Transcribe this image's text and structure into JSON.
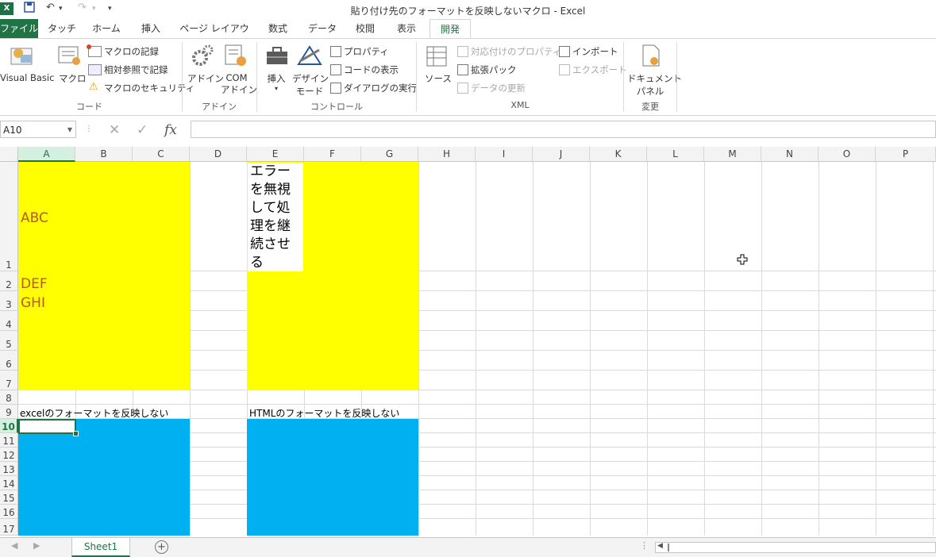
{
  "window": {
    "title": "貼り付け先のフォーマットを反映しないマクロ - Excel",
    "logo": "X"
  },
  "quick_access": {
    "save_icon": "save-icon",
    "undo_icon": "undo-icon",
    "redo_icon": "redo-icon",
    "customize": "▾"
  },
  "tabs": [
    "ファイル",
    "タッチ",
    "ホーム",
    "挿入",
    "ページ レイアウト",
    "数式",
    "データ",
    "校閲",
    "表示",
    "開発"
  ],
  "active_tab": "開発",
  "ribbon": {
    "code": {
      "vb": "Visual Basic",
      "macro": "マクロ",
      "record": "マクロの記録",
      "relative": "相対参照で記録",
      "security": "マクロのセキュリティ",
      "label": "コード"
    },
    "addins": {
      "addin": "アドイン",
      "com1": "COM",
      "com2": "アドイン",
      "label": "アドイン"
    },
    "controls": {
      "insert": "挿入",
      "design1": "デザイン",
      "design2": "モード",
      "props": "プロパティ",
      "viewcode": "コードの表示",
      "dialog": "ダイアログの実行",
      "label": "コントロール"
    },
    "xml": {
      "source": "ソース",
      "mapprops": "対応付けのプロパティ",
      "expansion": "拡張パック",
      "refresh": "データの更新",
      "import": "インポート",
      "export": "エクスポート",
      "label": "XML"
    },
    "modify": {
      "doc1": "ドキュメント",
      "doc2": "パネル",
      "label": "変更"
    }
  },
  "formula_bar": {
    "name_box": "A10",
    "cancel": "✕",
    "enter": "✓",
    "fx": "fx",
    "content": ""
  },
  "columns": [
    "A",
    "B",
    "C",
    "D",
    "E",
    "F",
    "G",
    "H",
    "I",
    "J",
    "K",
    "L",
    "M",
    "N",
    "O",
    "P"
  ],
  "rows": [
    "1",
    "2",
    "3",
    "4",
    "5",
    "6",
    "7",
    "8",
    "9",
    "10",
    "11",
    "12",
    "13",
    "14",
    "15",
    "16",
    "17"
  ],
  "cells": {
    "abc": "ABC",
    "def": "DEF",
    "ghi": "GHI",
    "e1": "エラーを無視して処理を継続させる",
    "a9": "excelのフォーマットを反映しない",
    "e9": "HTMLのフォーマットを反映しない"
  },
  "colors": {
    "yellow": "#ffff00",
    "blue": "#00b0f0",
    "excel_green": "#217346",
    "text_orange": "#b85a1a"
  },
  "sheet": {
    "tab": "Sheet1",
    "add": "+"
  }
}
